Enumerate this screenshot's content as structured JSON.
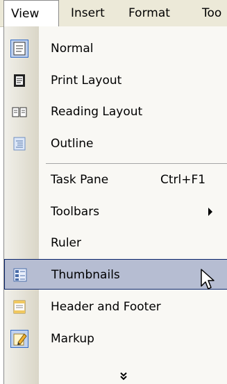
{
  "menubar": {
    "items": [
      {
        "label": "View",
        "active": true
      },
      {
        "label": "Insert"
      },
      {
        "label": "Format"
      },
      {
        "label": "Too"
      }
    ]
  },
  "view_menu": {
    "items": [
      {
        "label": "Normal",
        "icon": "normal-view-icon",
        "checked": true
      },
      {
        "label": "Print Layout",
        "icon": "print-layout-icon"
      },
      {
        "label": "Reading Layout",
        "icon": "reading-layout-icon"
      },
      {
        "label": "Outline",
        "icon": "outline-icon"
      },
      {
        "label": "Task Pane",
        "shortcut": "Ctrl+F1"
      },
      {
        "label": "Toolbars",
        "submenu": true
      },
      {
        "label": "Ruler"
      },
      {
        "label": "Thumbnails",
        "icon": "thumbnails-icon",
        "highlighted": true
      },
      {
        "label": "Header and Footer",
        "icon": "header-footer-icon"
      },
      {
        "label": "Markup",
        "icon": "markup-icon",
        "checked": true
      }
    ],
    "expand_glyph": "»"
  },
  "colors": {
    "menubar_bg": "#ece9d8",
    "highlight_bg": "#b6bdd2",
    "highlight_border": "#0a246a",
    "checked_bg": "#c1d2ee"
  }
}
